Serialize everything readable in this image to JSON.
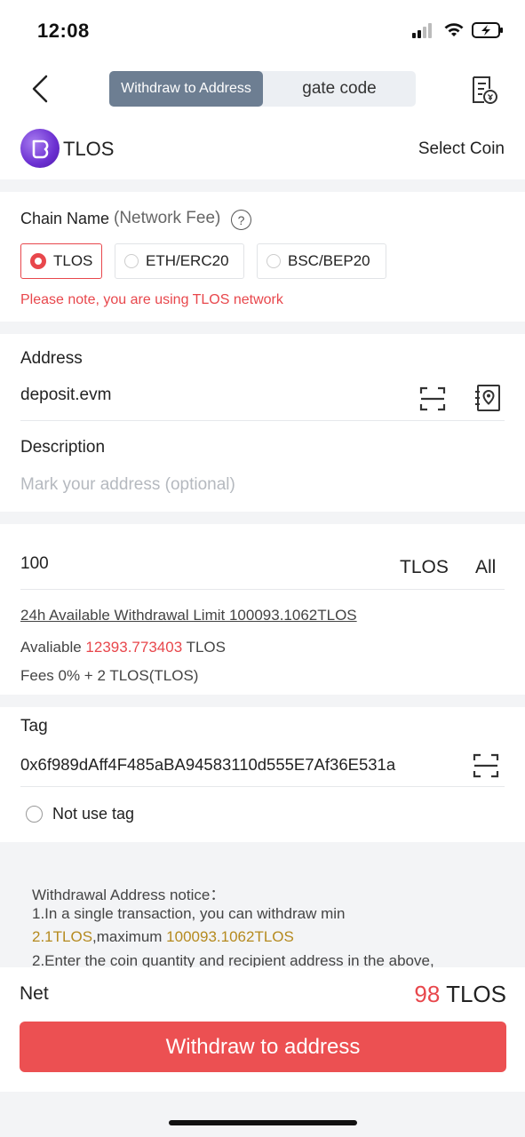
{
  "status": {
    "time": "12:08"
  },
  "nav": {
    "tab_withdraw": "Withdraw to Address",
    "tab_gate_code": "gate code"
  },
  "coin": {
    "name": "TLOS",
    "select_label": "Select Coin",
    "logo_color": "#6b2fd1"
  },
  "chain": {
    "label": "Chain Name",
    "fee_label": "(Network Fee)",
    "help": "?",
    "options": [
      "TLOS",
      "ETH/ERC20",
      "BSC/BEP20"
    ],
    "selected": "TLOS",
    "warning": "Please note, you are using TLOS network"
  },
  "address": {
    "label": "Address",
    "value": "deposit.evm",
    "description_label": "Description",
    "description_placeholder": "Mark your address (optional)"
  },
  "amount": {
    "value": "100",
    "unit": "TLOS",
    "all_label": "All",
    "limit_text": "24h Available Withdrawal Limit 100093.1062TLOS",
    "available_label": "Avaliable",
    "available_value": "12393.773403",
    "available_unit": "TLOS",
    "fees_text": "Fees 0% + 2 TLOS(TLOS)"
  },
  "tag": {
    "label": "Tag",
    "value": "0x6f989dAff4F485aBA94583110d555E7Af36E531a",
    "not_use_label": "Not use tag"
  },
  "notice": {
    "title": "Withdrawal Address notice：",
    "line1": "1.In a single transaction, you can withdraw min",
    "min_value": "2.1TLOS",
    "max_prefix": ",maximum ",
    "max_value": "100093.1062TLOS",
    "line2": "2.Enter the coin quantity and recipient address in the above,"
  },
  "net": {
    "label": "Net",
    "value": "98",
    "unit": "TLOS"
  },
  "button": {
    "withdraw": "Withdraw to address"
  },
  "colors": {
    "accent": "#e8474c",
    "gold": "#b58a1f",
    "segment_active": "#6d7e92"
  }
}
